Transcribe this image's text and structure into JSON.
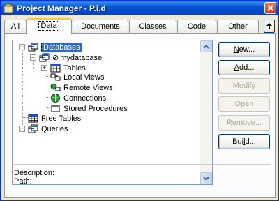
{
  "window": {
    "title": "Project Manager - P.i.d"
  },
  "tabs": [
    {
      "label": "All"
    },
    {
      "label": "Data"
    },
    {
      "label": "Documents"
    },
    {
      "label": "Classes"
    },
    {
      "label": "Code"
    },
    {
      "label": "Other"
    }
  ],
  "active_tab": "Data",
  "tree": {
    "databases": "Databases",
    "mydatabase": "mydatabase",
    "mydatabase_prefix": "⊘",
    "tables": "Tables",
    "local_views": "Local Views",
    "remote_views": "Remote Views",
    "connections": "Connections",
    "stored_procedures": "Stored Procedures",
    "free_tables": "Free Tables",
    "queries": "Queries"
  },
  "buttons": {
    "new": {
      "label_u": "N",
      "label_rest": "ew...",
      "enabled": true
    },
    "add": {
      "label_u": "A",
      "label_rest": "dd...",
      "enabled": true
    },
    "modify": {
      "label_u": "M",
      "label_rest": "odify",
      "enabled": false
    },
    "open": {
      "label_u": "O",
      "label_rest": "pen",
      "enabled": false
    },
    "remove": {
      "label_u": "R",
      "label_rest": "emove...",
      "enabled": false
    },
    "build": {
      "label_pre": "Bui",
      "label_u": "l",
      "label_rest": "d...",
      "enabled": true
    }
  },
  "info": {
    "description_label": "Description:",
    "path_label": "Path:"
  },
  "colors": {
    "titlebar": "#0455d6",
    "selection": "#316ac5",
    "active_tab_accent": "#ffc83c"
  }
}
